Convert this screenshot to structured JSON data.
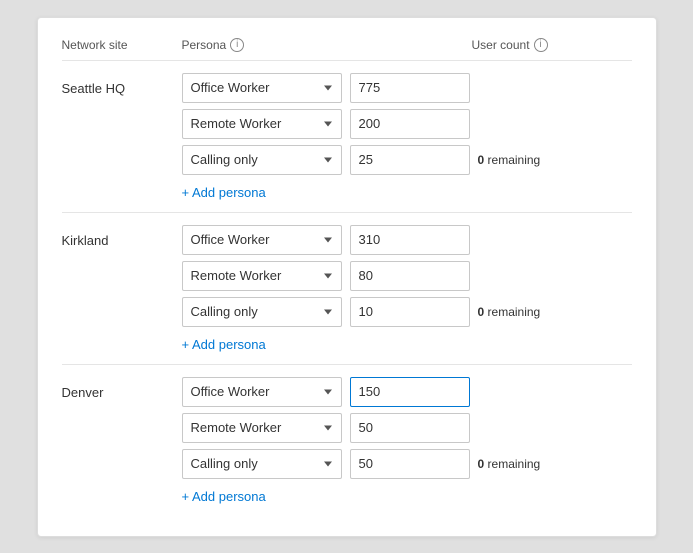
{
  "header": {
    "network_site": "Network site",
    "persona_label": "Persona",
    "user_count_label": "User count",
    "info_icon_symbol": "i"
  },
  "sites": [
    {
      "name": "Seattle HQ",
      "personas": [
        {
          "value": "Office Worker",
          "count": "775",
          "show_remaining": false
        },
        {
          "value": "Remote Worker",
          "count": "200",
          "show_remaining": false
        },
        {
          "value": "Calling only",
          "count": "25",
          "show_remaining": true,
          "remaining_count": "0"
        }
      ],
      "add_persona_label": "+ Add persona"
    },
    {
      "name": "Kirkland",
      "personas": [
        {
          "value": "Office Worker",
          "count": "310",
          "show_remaining": false
        },
        {
          "value": "Remote Worker",
          "count": "80",
          "show_remaining": false
        },
        {
          "value": "Calling only",
          "count": "10",
          "show_remaining": true,
          "remaining_count": "0"
        }
      ],
      "add_persona_label": "+ Add persona"
    },
    {
      "name": "Denver",
      "personas": [
        {
          "value": "Office Worker",
          "count": "150",
          "show_remaining": false,
          "focused": true
        },
        {
          "value": "Remote Worker",
          "count": "50",
          "show_remaining": false
        },
        {
          "value": "Calling only",
          "count": "50",
          "show_remaining": true,
          "remaining_count": "0"
        }
      ],
      "add_persona_label": "+ Add persona"
    }
  ],
  "persona_options": [
    "Office Worker",
    "Remote Worker",
    "Calling only"
  ],
  "remaining_label": "remaining"
}
